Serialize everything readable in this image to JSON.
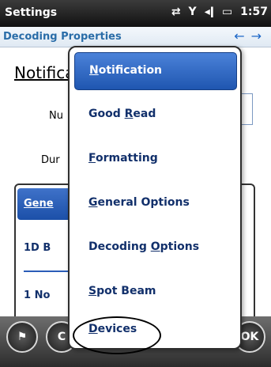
{
  "statusbar": {
    "title": "Settings",
    "time": "1:57"
  },
  "pagebar": {
    "title": "Decoding Properties"
  },
  "content": {
    "heading": "Notificatio",
    "field1_label": "Nu",
    "field2_label": "Dur",
    "group_tab": "Gene",
    "list_item1": "1D B",
    "list_item2": "1 No"
  },
  "menu": {
    "items": [
      {
        "label": "Notification",
        "accel": "N",
        "rest": "otification",
        "selected": true
      },
      {
        "label": "Good Read",
        "pre": "Good ",
        "accel": "R",
        "rest": "ead"
      },
      {
        "label": "Formatting",
        "accel": "F",
        "rest": "ormatting"
      },
      {
        "label": "General Options",
        "accel": "G",
        "rest": "eneral Options"
      },
      {
        "label": "Decoding Options",
        "pre": "Decoding ",
        "accel": "O",
        "rest": "ptions"
      },
      {
        "label": "Spot Beam",
        "accel": "S",
        "rest": "pot Beam"
      },
      {
        "label": "Devices",
        "accel": "D",
        "rest": "evices"
      }
    ]
  },
  "taskbar": {
    "start_label": "",
    "left_partial": "C",
    "ok_label": "OK"
  }
}
